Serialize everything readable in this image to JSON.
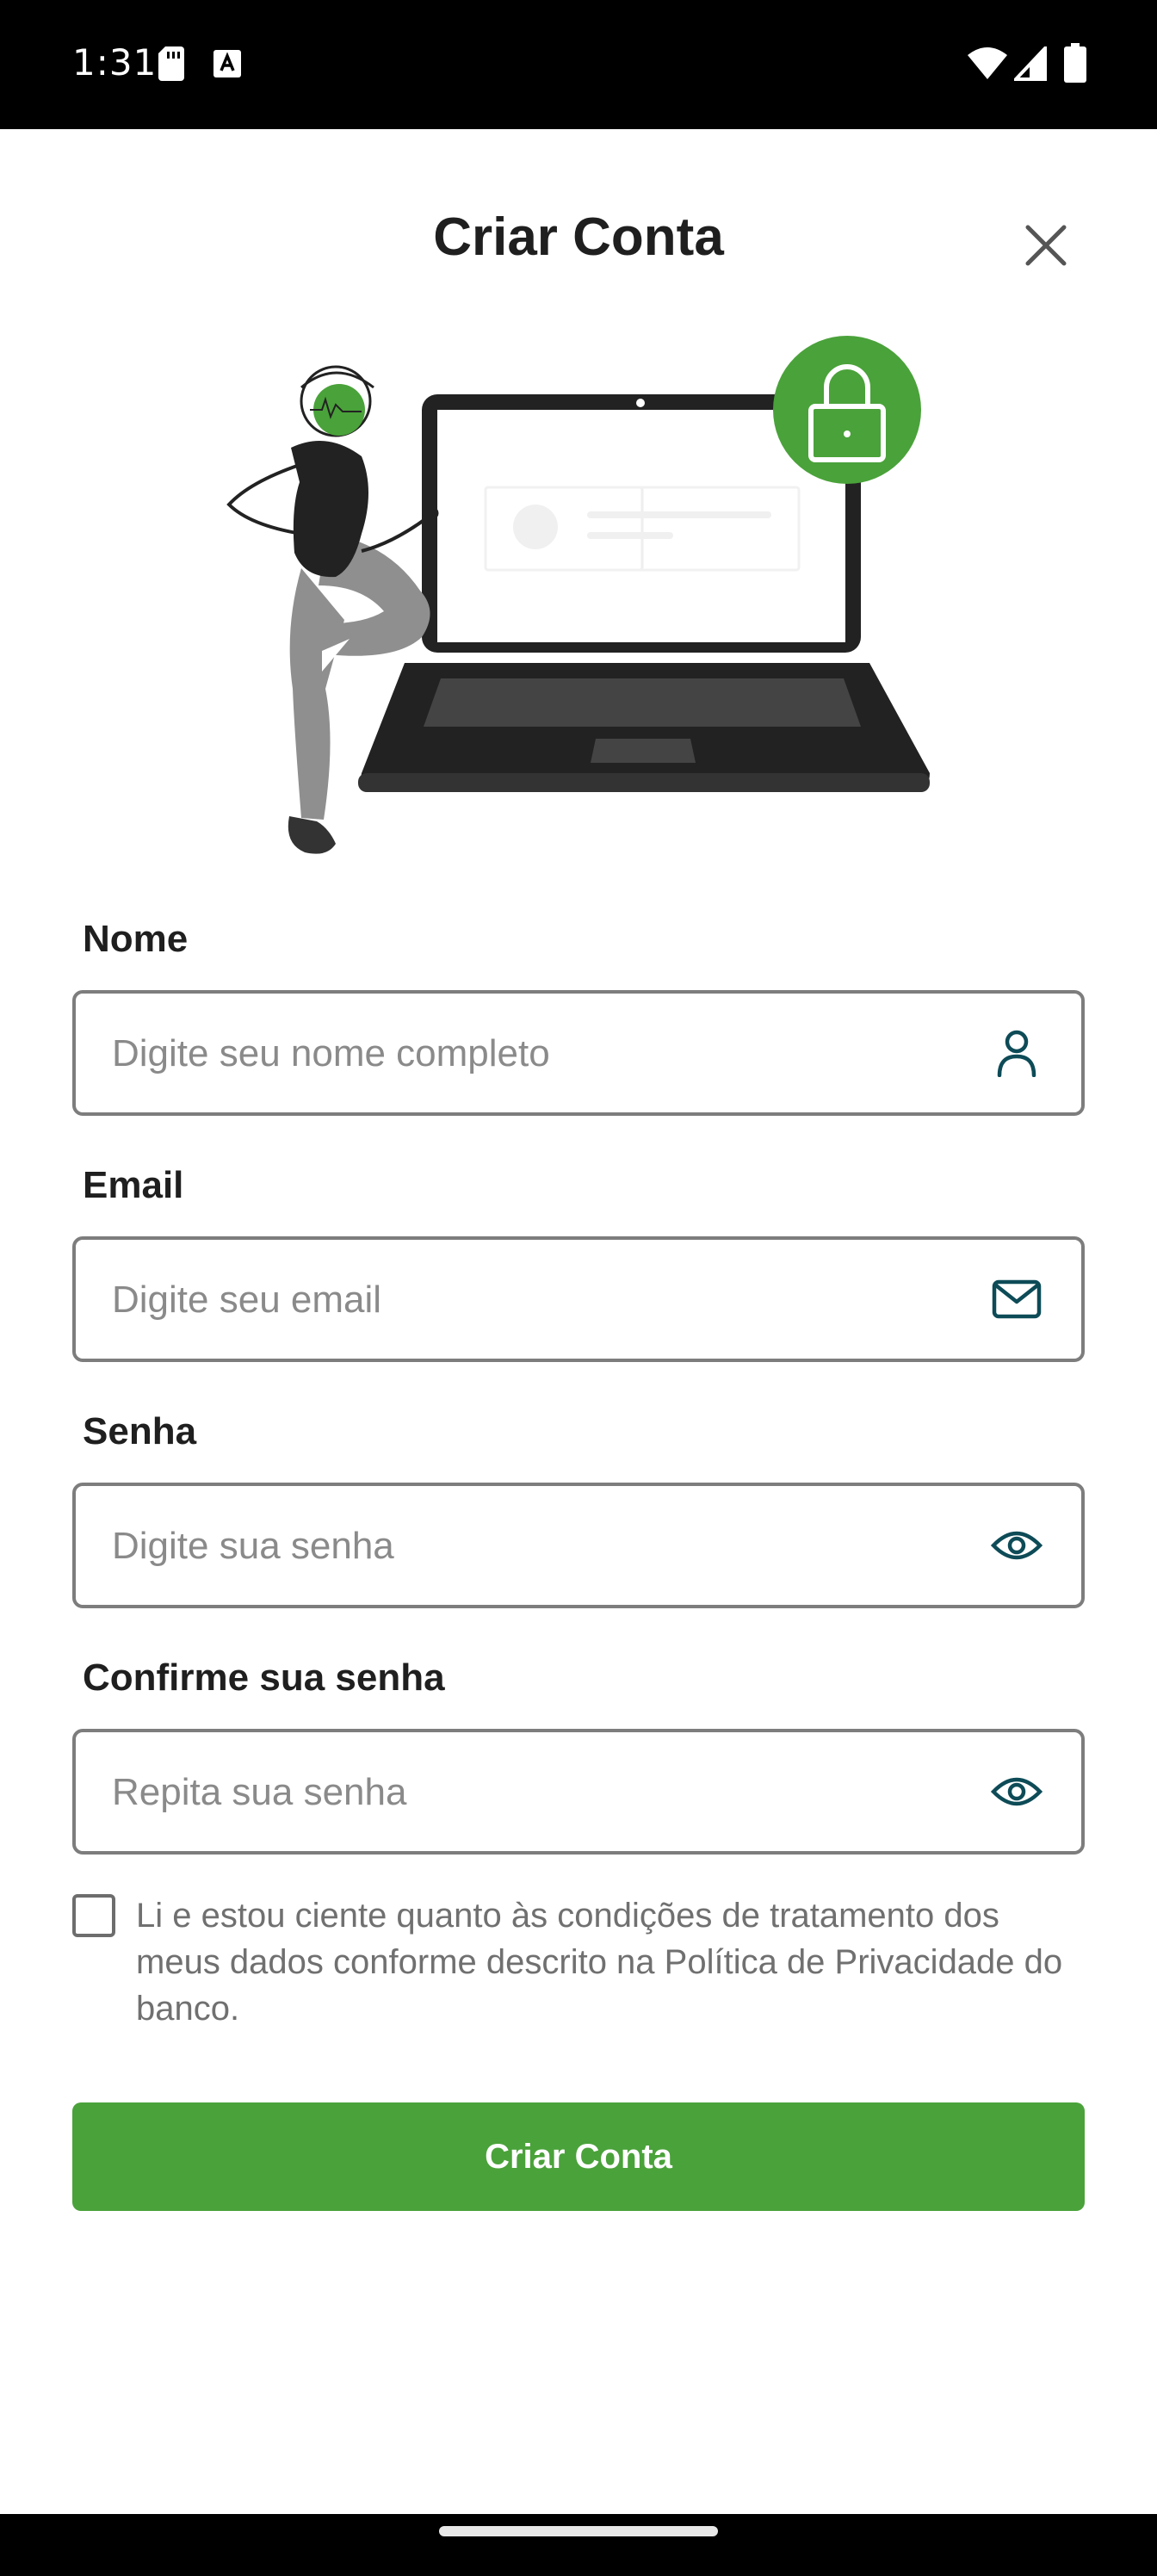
{
  "status_bar": {
    "time": "1:31",
    "icons": [
      "sd-card-icon",
      "a-badge-icon",
      "wifi-icon",
      "signal-icon",
      "battery-icon"
    ]
  },
  "header": {
    "title": "Criar Conta",
    "close_icon": "close-icon"
  },
  "illustration": {
    "description_icon": "laptop-lock-illustration",
    "accent_color": "#4aa23a"
  },
  "form": {
    "name": {
      "label": "Nome",
      "placeholder": "Digite seu nome completo",
      "value": "",
      "icon": "person-icon"
    },
    "email": {
      "label": "Email",
      "placeholder": "Digite seu email",
      "value": "",
      "icon": "mail-icon"
    },
    "password": {
      "label": "Senha",
      "placeholder": "Digite sua senha",
      "value": "",
      "icon": "eye-icon"
    },
    "confirm_password": {
      "label": "Confirme sua senha",
      "placeholder": "Repita sua senha",
      "value": "",
      "icon": "eye-icon"
    }
  },
  "consent": {
    "checked": false,
    "text": "Li e estou ciente quanto às condições de tratamento dos meus dados conforme descrito na Política de Privacidade do banco."
  },
  "submit": {
    "label": "Criar Conta"
  },
  "colors": {
    "primary": "#4aa23a",
    "icon_teal": "#0d4b57",
    "border": "#7d7d7d",
    "placeholder": "#8a8a8a"
  }
}
